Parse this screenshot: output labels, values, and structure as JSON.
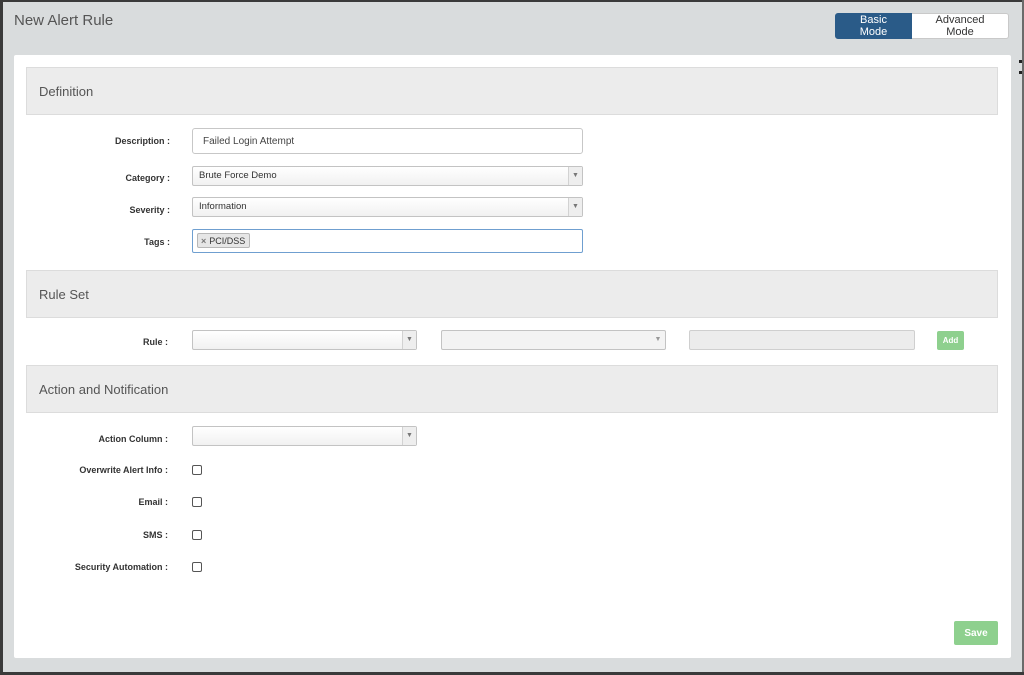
{
  "header": {
    "title": "New Alert Rule",
    "basic_mode_label": "Basic Mode",
    "advanced_mode_label": "Advanced Mode"
  },
  "definition": {
    "heading": "Definition",
    "description_label": "Description :",
    "description_value": "Failed Login Attempt",
    "category_label": "Category :",
    "category_value": "Brute Force Demo",
    "severity_label": "Severity :",
    "severity_value": "Information",
    "tags_label": "Tags :",
    "tags": [
      "PCI/DSS"
    ]
  },
  "rule_set": {
    "heading": "Rule Set",
    "rule_label": "Rule :",
    "add_label": "Add"
  },
  "action": {
    "heading": "Action and Notification",
    "action_column_label": "Action Column :",
    "overwrite_label": "Overwrite Alert Info :",
    "email_label": "Email :",
    "sms_label": "SMS :",
    "security_automation_label": "Security Automation :"
  },
  "footer": {
    "save_label": "Save"
  },
  "colors": {
    "primary": "#2a5b88",
    "success_disabled": "#8ed08e",
    "section_bg": "#ececec"
  }
}
